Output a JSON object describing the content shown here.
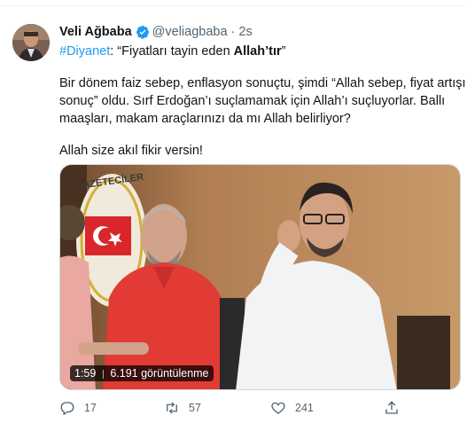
{
  "tweet": {
    "author_name": "Veli Ağbaba",
    "handle": "@veliagbaba",
    "separator": "·",
    "time": "2s",
    "line1_hashtag": "#Diyanet",
    "line1_text": ": “Fiyatları tayin eden ",
    "line1_bold": "Allah’tır",
    "line1_end": "”",
    "body_line1": "Bir dönem faiz sebep, enflasyon sonuçtu, şimdi “Allah sebep, fiyat artışı",
    "body_line2": "sonuç” oldu. Sırf Erdoğan’ı suçlamamak için Allah’ı suçluyorlar. Ballı",
    "body_line3": "maaşları, makam araçlarınızı da mı Allah belirliyor?",
    "body_line4": "Allah size akıl fikir versin!"
  },
  "video": {
    "duration": "1:59",
    "views": "6.191 görüntülenme",
    "logo_text": "GAZETECİLER"
  },
  "actions": {
    "reply_count": "17",
    "retweet_count": "57",
    "like_count": "241"
  },
  "colors": {
    "link": "#1d9bf0",
    "muted": "#536471",
    "text": "#0f1419",
    "verified": "#1d9bf0"
  },
  "icons": [
    "verified-badge-icon",
    "reply-icon",
    "retweet-icon",
    "like-icon",
    "share-icon"
  ]
}
